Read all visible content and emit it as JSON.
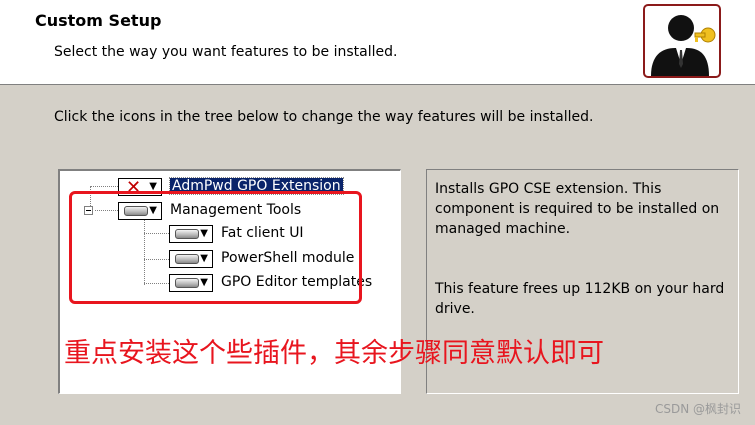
{
  "header": {
    "title": "Custom Setup",
    "subtitle": "Select the way you want features to be installed."
  },
  "instruction": "Click the icons in the tree below to change the way features will be installed.",
  "tree": {
    "items": [
      {
        "label": "AdmPwd GPO Extension",
        "state": "not-installed",
        "selected": true
      },
      {
        "label": "Management Tools",
        "state": "installed",
        "expanded": true
      },
      {
        "label": "Fat client UI",
        "state": "installed"
      },
      {
        "label": "PowerShell module",
        "state": "installed"
      },
      {
        "label": "GPO Editor templates",
        "state": "installed"
      }
    ]
  },
  "description": {
    "text": "Installs GPO CSE extension. This component is required to be installed on managed machine.",
    "size_text": "This feature frees up 112KB on your hard drive."
  },
  "annotation": {
    "text": "重点安装这个些插件，其余步骤同意默认即可",
    "color": "#e8151e"
  },
  "watermark": "CSDN @枫封识",
  "colors": {
    "selection": "#0a246a",
    "dialog_bg": "#d4d0c8",
    "not_installed_x": "#c00000"
  },
  "icons": {
    "header": "user-key-icon",
    "not_installed": "red-x-icon",
    "installed": "drive-icon",
    "dropdown": "dropdown-arrow-icon"
  }
}
